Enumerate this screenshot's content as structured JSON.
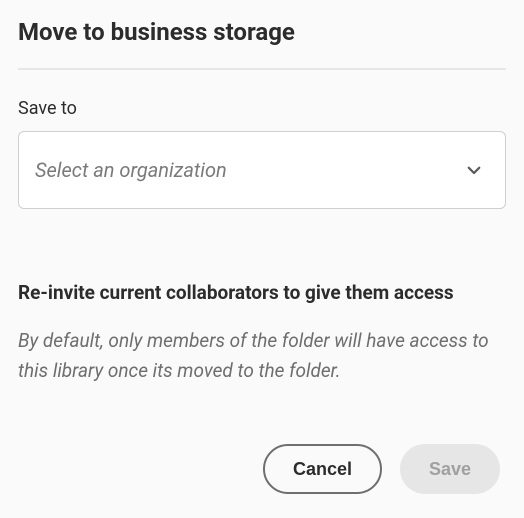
{
  "dialog": {
    "title": "Move to business storage",
    "save_to_label": "Save to",
    "org_placeholder": "Select an organization",
    "reinvite_heading": "Re-invite current collaborators to give them access",
    "reinvite_description": "By default, only members of the folder will have access to this library once its moved to the folder.",
    "cancel_label": "Cancel",
    "save_label": "Save"
  }
}
